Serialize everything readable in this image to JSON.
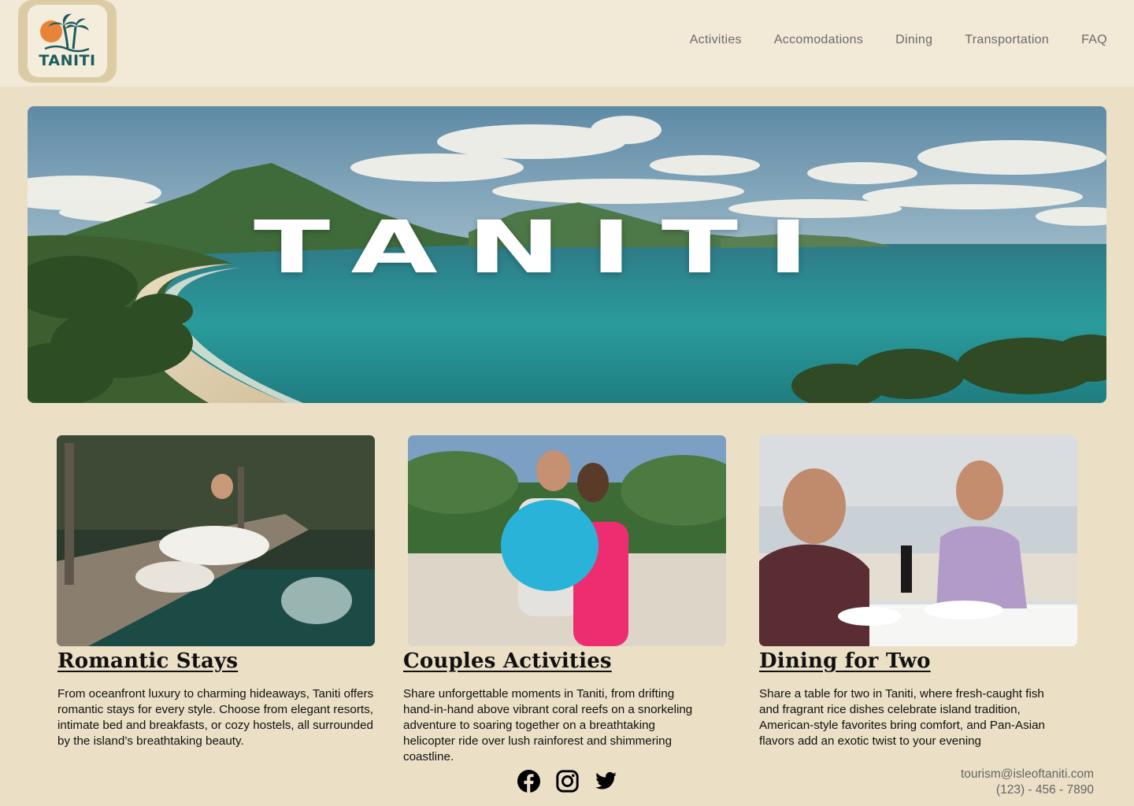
{
  "logo": {
    "text": "TANITI",
    "icon": "palm-tree-sun-icon"
  },
  "nav": {
    "items": [
      "Activities",
      "Accomodations",
      "Dining",
      "Transportation",
      "FAQ"
    ]
  },
  "hero": {
    "title": "TANITI"
  },
  "cards": [
    {
      "title": "Romantic Stays",
      "text": "From oceanfront luxury to charming hideaways, Taniti offers romantic stays for every style. Choose from elegant resorts, intimate bed and breakfasts, or cozy hostels, all surrounded by the island’s breathtaking beauty."
    },
    {
      "title": "Couples Activities",
      "text": "Share unforgettable moments in Taniti, from drifting hand-in-hand above vibrant coral reefs on a snorkeling adventure to soaring together on a breathtaking helicopter ride over lush rainforest and shimmering coastline."
    },
    {
      "title": "Dining for Two",
      "text": "Share a table for two in Taniti, where fresh-caught fish and fragrant rice dishes celebrate island tradition, American-style favorites bring comfort, and Pan-Asian flavors add an exotic twist to your evening"
    }
  ],
  "social": [
    "facebook-icon",
    "instagram-icon",
    "twitter-icon"
  ],
  "contact": {
    "email": "tourism@isleoftaniti.com",
    "phone": "(123) - 456 - 7890"
  }
}
